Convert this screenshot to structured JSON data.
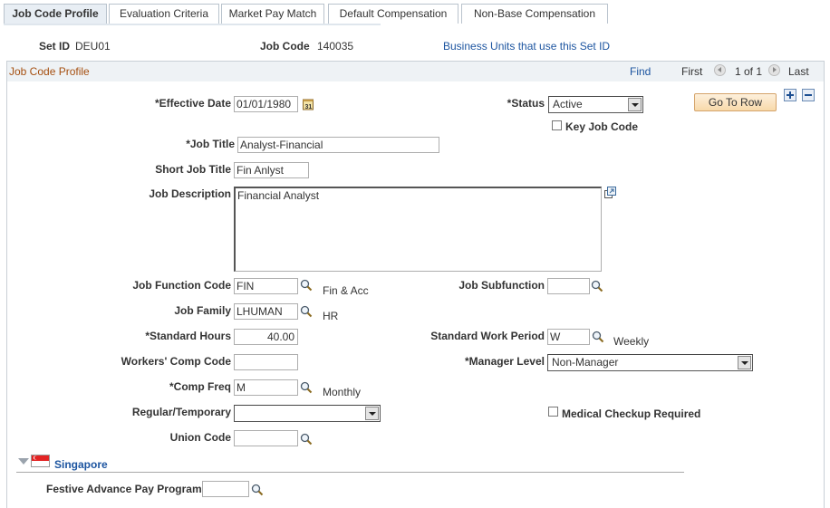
{
  "tabs": [
    {
      "label": "Job Code Profile",
      "active": true
    },
    {
      "label": "Evaluation Criteria",
      "active": false,
      "accesskey": "E"
    },
    {
      "label": "Market Pay Match",
      "active": false,
      "accesskey": "M"
    },
    {
      "label": "Default Compensation",
      "active": false,
      "accesskey": "D"
    },
    {
      "label": "Non-Base Compensation",
      "active": false,
      "accesskey": "N"
    }
  ],
  "header": {
    "setid_label": "Set ID",
    "setid_value": "DEU01",
    "jobcode_label": "Job Code",
    "jobcode_value": "140035",
    "bu_link": "Business Units that use this Set ID"
  },
  "scroll": {
    "title": "Job Code Profile",
    "find": "Find",
    "first": "First",
    "position": "1 of 1",
    "last": "Last",
    "goto_row": "Go To Row"
  },
  "fields": {
    "effective_date": {
      "label": "*Effective Date",
      "value": "01/01/1980"
    },
    "status": {
      "label": "*Status",
      "value": "Active"
    },
    "key_job_code": {
      "label": "Key Job Code",
      "checked": false
    },
    "job_title": {
      "label": "*Job Title",
      "value": "Analyst-Financial"
    },
    "short_job_title": {
      "label": "Short Job Title",
      "value": "Fin Anlyst"
    },
    "job_description": {
      "label": "Job Description",
      "value": "Financial Analyst"
    },
    "job_function_code": {
      "label": "Job Function Code",
      "value": "FIN",
      "description": "Fin & Acc"
    },
    "job_subfunction": {
      "label": "Job Subfunction",
      "value": ""
    },
    "job_family": {
      "label": "Job Family",
      "value": "LHUMAN",
      "description": "HR"
    },
    "standard_hours": {
      "label": "*Standard Hours",
      "value": "40.00"
    },
    "standard_work_period": {
      "label": "Standard Work Period",
      "value": "W",
      "description": "Weekly"
    },
    "workers_comp_code": {
      "label": "Workers' Comp Code",
      "value": ""
    },
    "manager_level": {
      "label": "*Manager Level",
      "value": "Non-Manager"
    },
    "comp_freq": {
      "label": "*Comp Freq",
      "value": "M",
      "description": "Monthly"
    },
    "regular_temporary": {
      "label": "Regular/Temporary",
      "value": ""
    },
    "medical_checkup": {
      "label": "Medical Checkup Required",
      "checked": false
    },
    "union_code": {
      "label": "Union Code",
      "value": ""
    }
  },
  "singapore": {
    "title": "Singapore",
    "festive_label": "Festive Advance Pay Program",
    "festive_value": ""
  },
  "colors": {
    "scroll_title": "#a54f10",
    "link": "#1d55a0",
    "goto_bg": "#f8d9aa"
  }
}
